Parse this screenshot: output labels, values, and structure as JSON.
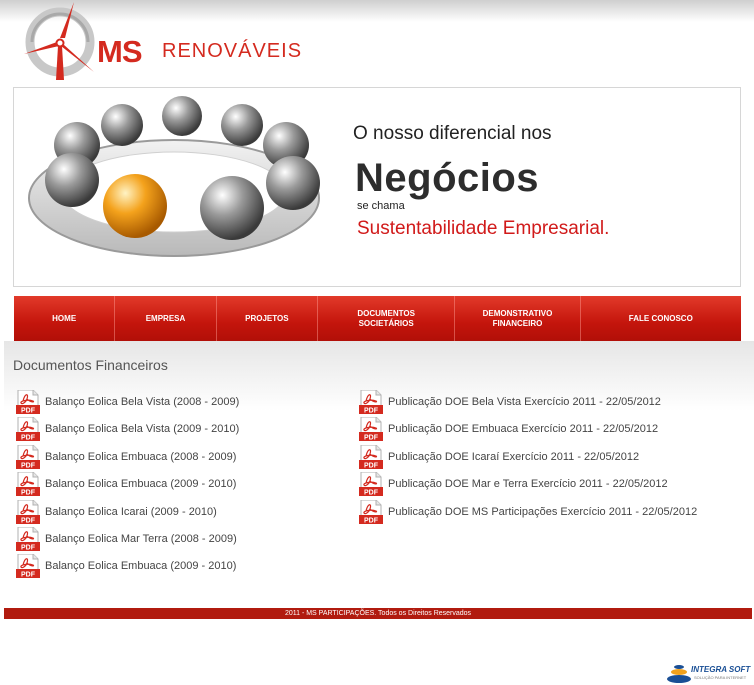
{
  "logo": {
    "ms": "MS",
    "renovaveis": "RENOVÁVEIS"
  },
  "banner": {
    "line1": "O nosso diferencial nos",
    "line2": "Negócios",
    "line3": "se chama",
    "line4": "Sustentabilidade Empresarial."
  },
  "nav": {
    "items": [
      {
        "label": "HOME"
      },
      {
        "label": "EMPRESA"
      },
      {
        "label": "PROJETOS"
      },
      {
        "label": "DOCUMENTOS SOCIETÁRIOS"
      },
      {
        "label": "DEMONSTRATIVO FINANCEIRO"
      },
      {
        "label": "FALE CONOSCO"
      }
    ]
  },
  "section": {
    "title": "Documentos Financeiros"
  },
  "docs": {
    "icon_label": "PDF",
    "left": [
      "Balanço Eolica Bela Vista (2008 - 2009)",
      "Balanço Eolica Bela Vista (2009 - 2010)",
      "Balanço Eolica Embuaca (2008 - 2009)",
      "Balanço Eolica Embuaca (2009 - 2010)",
      "Balanço Eolica Icarai (2009 - 2010)",
      "Balanço Eolica Mar Terra (2008 - 2009)",
      "Balanço Eolica Embuaca (2009 - 2010)"
    ],
    "right": [
      "Publicação DOE Bela Vista Exercício 2011 - 22/05/2012",
      "Publicação DOE Embuaca Exercício 2011 - 22/05/2012",
      "Publicação DOE Icaraí Exercício 2011 - 22/05/2012",
      "Publicação DOE Mar e Terra Exercício 2011 - 22/05/2012",
      "Publicação DOE MS Participações Exercício 2011 - 22/05/2012"
    ]
  },
  "footer": {
    "text": "2011 - MS PARTICIPAÇÕES. Todos os Direitos Reservados"
  },
  "credit": {
    "name": "INTEGRA SOFT",
    "tagline": "SOLUÇÃO PARA INTERNET"
  },
  "colors": {
    "brand_red": "#d42a1f",
    "nav_red": "#c4150c",
    "footer_red": "#b11b0f"
  }
}
